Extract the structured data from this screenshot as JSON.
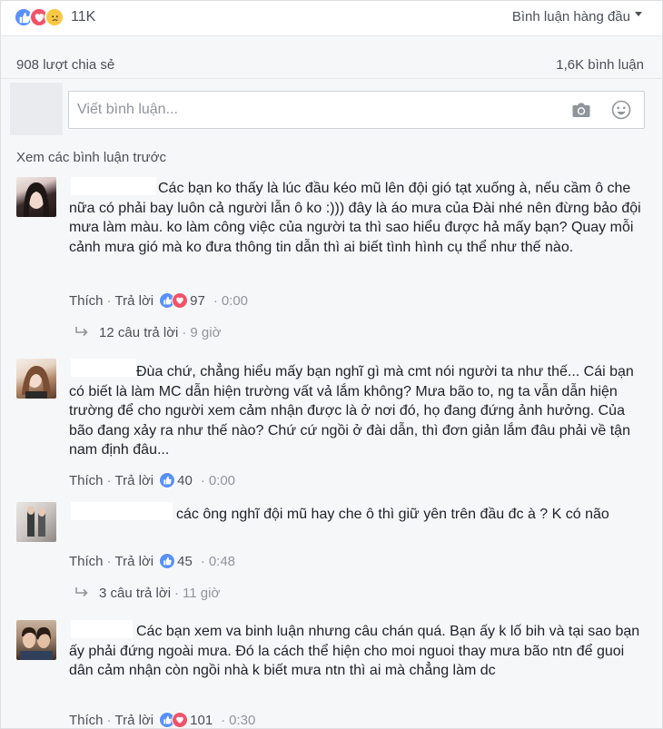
{
  "reactions": {
    "count": "11K",
    "types": [
      "like-icon",
      "love-icon",
      "sad-icon"
    ]
  },
  "sort": {
    "label": "Bình luận hàng đầu"
  },
  "stats": {
    "shares": "908 lượt chia sẻ",
    "comments": "1,6K bình luận"
  },
  "composer": {
    "placeholder": "Viết bình luận..."
  },
  "prev_link": "Xem các bình luận trước",
  "actions": {
    "like": "Thích",
    "reply": "Trả lời",
    "sep": "·"
  },
  "comments": [
    {
      "text": "Các bạn ko thấy là lúc đầu kéo mũ lên đội gió tạt xuống à, nếu cầm ô che nữa có phải bay luôn cả người lẫn ô ko :))) đây là áo mưa của Đài nhé nên đừng bảo đội mưa làm màu. ko làm công việc của người ta thì sao hiểu được hả mấy bạn? Quay mỗi cảnh mưa gió mà ko đưa thông tin dẫn thì ai biết tình hình cụ thể như thế nào.",
      "reaction_icons": [
        "like-icon",
        "love-icon"
      ],
      "reactions": "97",
      "time": "0:00",
      "replies": "12 câu trả lời",
      "replies_time": "9 giờ"
    },
    {
      "text": "Đùa chứ, chẳng hiểu mấy bạn nghĩ gì mà cmt nói người ta như thế... Cái bạn có biết là làm MC dẫn hiện trường vất vả lắm không? Mưa bão to, ng ta vẫn dẫn hiện trường để cho người xem cảm nhận được là ở nơi đó, họ đang đứng ảnh hưởng. Của bão đang xảy ra như thế nào? Chứ cứ ngồi ở đài dẫn, thì đơn giản lắm đâu phải về tận nam định đâu...",
      "reaction_icons": [
        "like-icon"
      ],
      "reactions": "40",
      "time": "0:00"
    },
    {
      "text": "các ông nghĩ đội mũ hay che ô thì giữ yên trên đầu đc à ? K có não",
      "reaction_icons": [
        "like-icon"
      ],
      "reactions": "45",
      "time": "0:48",
      "replies": "3 câu trả lời",
      "replies_time": "11 giờ"
    },
    {
      "text": "Các bạn xem va binh luận nhưng câu chán quá. Bạn ấy k lố bih và tại sao bạn ấy phải đứng ngoài mưa. Đó la cách thể hiện cho moi nguoi thay mưa bão ntn để guoi dân cảm nhận còn ngồi nhà k biết mưa ntn thì ai mà chẳng làm dc",
      "reaction_icons": [
        "like-icon",
        "love-icon"
      ],
      "reactions": "101",
      "time": "0:30"
    }
  ],
  "colors": {
    "link": "#4b4f56",
    "meta": "#90949c",
    "like": "#5890ff",
    "love": "#f25268",
    "sad": "#f7c843",
    "bg": "#f6f7f9"
  }
}
